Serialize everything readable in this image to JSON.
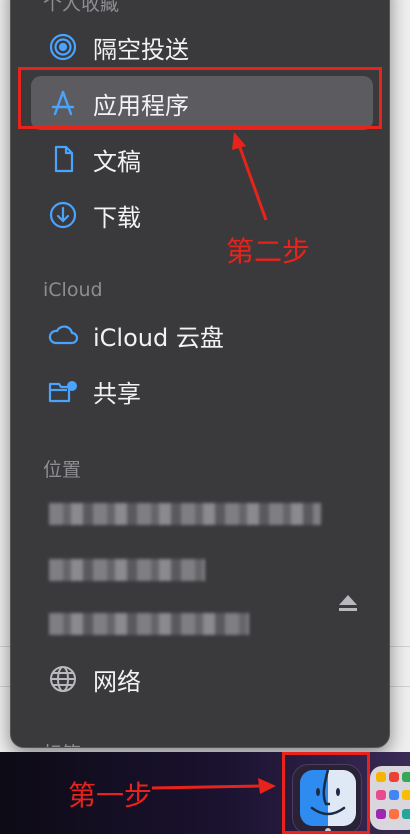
{
  "sidebar": {
    "favorites_title": "个人收藏",
    "favorites": [
      {
        "label": "隔空投送",
        "icon": "airdrop-icon"
      },
      {
        "label": "应用程序",
        "icon": "applications-icon"
      },
      {
        "label": "文稿",
        "icon": "documents-icon"
      },
      {
        "label": "下载",
        "icon": "downloads-icon"
      }
    ],
    "icloud_title": "iCloud",
    "icloud": [
      {
        "label": "iCloud 云盘",
        "icon": "cloud-icon"
      },
      {
        "label": "共享",
        "icon": "shared-folder-icon"
      }
    ],
    "locations_title": "位置",
    "network_label": "网络",
    "tags_title": "标签"
  },
  "annotations": {
    "step1": "第一步",
    "step2": "第二步",
    "color": "#e8231b"
  },
  "colors": {
    "icon_accent": "#4aa3ff",
    "sidebar_bg": "#3a3a3d",
    "selected_bg": "#5b5b60"
  }
}
